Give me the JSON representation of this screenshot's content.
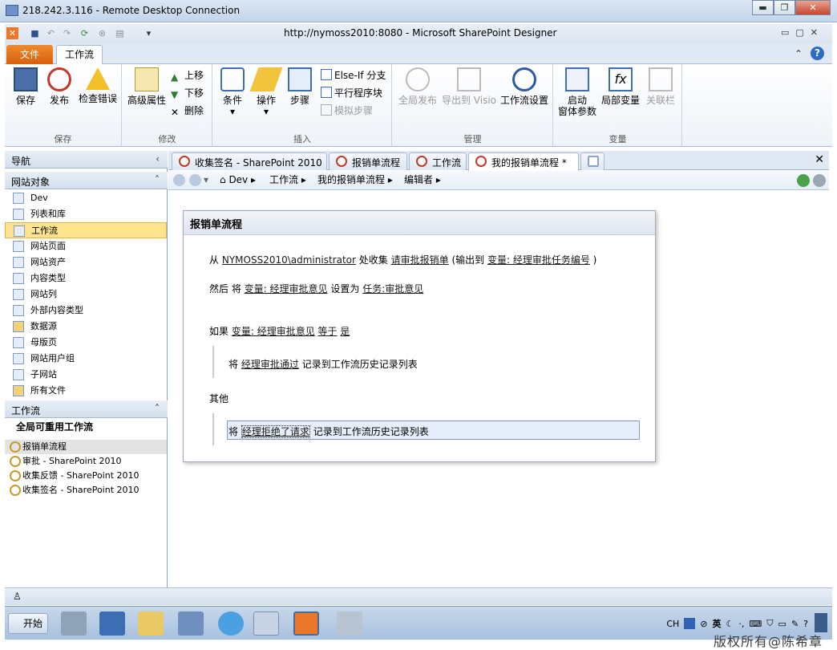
{
  "rdp": {
    "title": "218.242.3.116 - Remote Desktop Connection",
    "min": "▬",
    "restore": "❐",
    "close": "✕"
  },
  "spd": {
    "title": "http://nymoss2010:8080  -  Microsoft SharePoint Designer"
  },
  "ribbon_tabs": {
    "file": "文件",
    "workflow": "工作流"
  },
  "ribbon": {
    "groups": {
      "save": "保存",
      "modify": "修改",
      "insert": "插入",
      "manage": "管理",
      "variables": "变量"
    },
    "save": "保存",
    "publish": "发布",
    "check": "检查错误",
    "adv_props": "高级属性",
    "move_up": "上移",
    "move_down": "下移",
    "delete": "删除",
    "condition": "条件",
    "action": "操作",
    "step": "步骤",
    "else_if": "Else-If 分支",
    "parallel": "平行程序块",
    "impersonation": "模拟步骤",
    "global_publish": "全局发布",
    "export_visio": "导出到 Visio",
    "wf_settings": "工作流设置",
    "init_params_1": "启动",
    "init_params_2": "窗体参数",
    "local_vars": "局部变量",
    "assoc_cols": "关联栏"
  },
  "nav": {
    "header": "导航",
    "site_objects": "网站对象",
    "items": [
      "Dev",
      "列表和库",
      "工作流",
      "网站页面",
      "网站资产",
      "内容类型",
      "网站列",
      "外部内容类型",
      "数据源",
      "母版页",
      "网站用户组",
      "子网站",
      "所有文件"
    ],
    "wf_header": "工作流",
    "wf_group": "全局可重用工作流",
    "wf_items": [
      "报销单流程",
      "审批 - SharePoint 2010",
      "收集反馈 - SharePoint 2010",
      "收集签名 - SharePoint 2010"
    ]
  },
  "tabs": [
    "收集签名 - SharePoint 2010",
    "报销单流程",
    "工作流",
    "我的报销单流程 *"
  ],
  "breadcrumb": [
    "Dev",
    "工作流",
    "我的报销单流程",
    "编辑者"
  ],
  "card": {
    "title": "报销单流程",
    "l1": {
      "a": "从",
      "user": "NYMOSS2010\\administrator",
      "b": "处收集",
      "item": "请审批报销单",
      "c": "(输出到",
      "var": "变量: 经理审批任务编号",
      "d": ")"
    },
    "l2": {
      "a": "然后 将",
      "var": "变量: 经理审批意见",
      "b": "设置为",
      "val": "任务:审批意见"
    },
    "l3": {
      "a": "如果",
      "var": "变量: 经理审批意见",
      "op": "等于",
      "val": "是"
    },
    "l4": {
      "a": "将",
      "msg": "经理审批通过",
      "b": "记录到工作流历史记录列表"
    },
    "l5": "其他",
    "l6": {
      "a": "将",
      "msg": "经理拒绝了请求",
      "b": "记录到工作流历史记录列表"
    }
  },
  "taskbar": {
    "start": "开始",
    "lang": "CH",
    "ime": "英"
  },
  "watermark": "版权所有@陈希章"
}
